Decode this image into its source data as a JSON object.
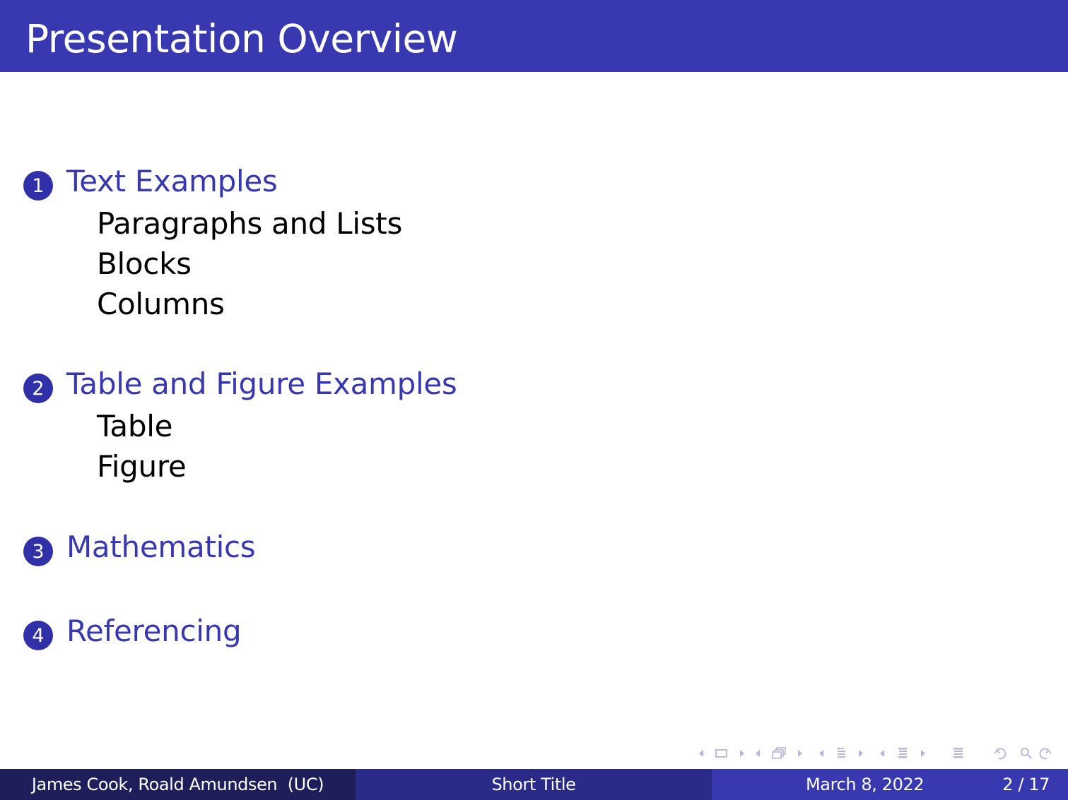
{
  "slide": {
    "title": "Presentation Overview"
  },
  "toc": {
    "sections": [
      {
        "number": "1",
        "label": "Text Examples",
        "subsections": [
          "Paragraphs and Lists",
          "Blocks",
          "Columns"
        ]
      },
      {
        "number": "2",
        "label": "Table and Figure Examples",
        "subsections": [
          "Table",
          "Figure"
        ]
      },
      {
        "number": "3",
        "label": "Mathematics",
        "subsections": []
      },
      {
        "number": "4",
        "label": "Referencing",
        "subsections": []
      }
    ]
  },
  "navigation": {
    "icons": [
      "prev-arrow-icon",
      "slide-frame-icon",
      "next-arrow-icon",
      "prev-arrow-icon",
      "stacked-frames-icon",
      "next-arrow-icon",
      "prev-arrow-icon",
      "subsection-list-icon",
      "next-arrow-icon",
      "prev-arrow-icon",
      "section-list-icon",
      "next-arrow-icon",
      "document-list-icon",
      "undo-icon",
      "search-icon",
      "redo-icon"
    ]
  },
  "footer": {
    "author": "James Cook, Roald Amundsen  (UC)",
    "short_title": "Short Title",
    "date": "March 8, 2022",
    "page": "2 / 17"
  },
  "colors": {
    "primary": "#3838b0",
    "footer_dark": "#1e1e5a",
    "footer_mid": "#2a2a88",
    "nav_icons": "#b4b4e0"
  }
}
